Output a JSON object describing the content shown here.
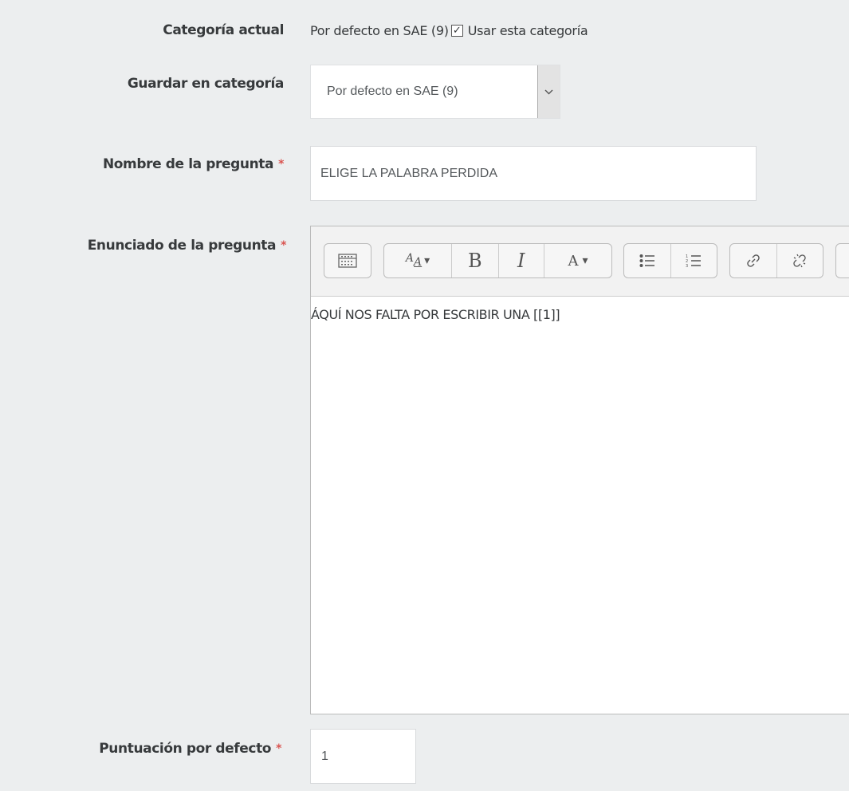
{
  "fields": {
    "current_category": {
      "label": "Categoría actual",
      "value": "Por defecto en SAE (9)",
      "checkbox_checked": true,
      "checkbox_label": "Usar esta categoría"
    },
    "save_category": {
      "label": "Guardar en categoría",
      "selected": "Por defecto en SAE (9)"
    },
    "question_name": {
      "label": "Nombre de la pregunta",
      "value": "ELIGE LA PALABRA PERDIDA"
    },
    "question_text": {
      "label": "Enunciado de la pregunta",
      "content": "ÁQUÍ NOS FALTA POR ESCRIBIR UNA [[1]]"
    },
    "default_mark": {
      "label": "Puntuación por defecto",
      "value": "1"
    }
  },
  "required_marker": "*",
  "toolbar": {
    "font_style_glyph": "A",
    "bold_glyph": "B",
    "italic_glyph": "I",
    "font_color_glyph": "A",
    "dropdown_glyph": "▾"
  },
  "colors": {
    "background": "#eceeef",
    "required": "#d9534f"
  }
}
